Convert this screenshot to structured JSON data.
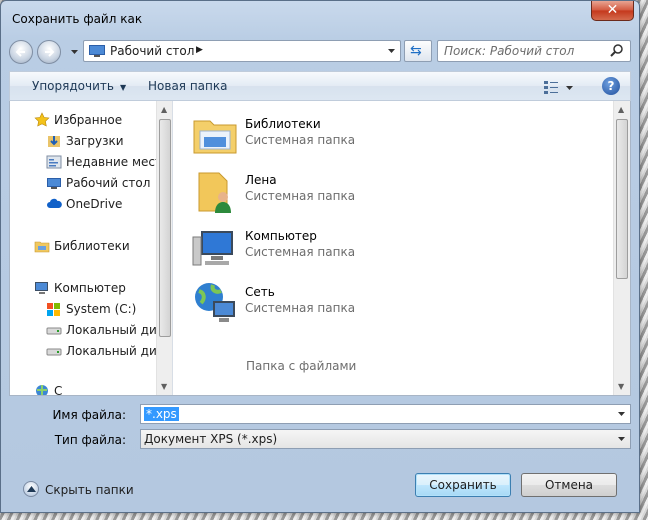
{
  "window": {
    "title": "Сохранить файл как",
    "close_glyph": "✕"
  },
  "navbar": {
    "address": "Рабочий стол",
    "address_arrow": "▶",
    "search_placeholder": "Поиск: Рабочий стол"
  },
  "toolbar": {
    "organize_label": "Упорядочить",
    "new_folder_label": "Новая папка",
    "help_glyph": "?"
  },
  "sidebar": {
    "items": [
      {
        "label": "Избранное",
        "icon": "star-icon"
      },
      {
        "label": "Загрузки",
        "icon": "downloads-icon"
      },
      {
        "label": "Недавние места",
        "icon": "recent-places-icon"
      },
      {
        "label": "Рабочий стол",
        "icon": "desktop-icon"
      },
      {
        "label": "OneDrive",
        "icon": "onedrive-icon"
      },
      {
        "label": "Библиотеки",
        "icon": "libraries-icon"
      },
      {
        "label": "Компьютер",
        "icon": "computer-icon"
      },
      {
        "label": "System (C:)",
        "icon": "system-drive-icon"
      },
      {
        "label": "Локальный диск",
        "icon": "local-disk-icon"
      },
      {
        "label": "Локальный диск",
        "icon": "local-disk-icon"
      },
      {
        "label": "С",
        "icon": "network-icon"
      }
    ]
  },
  "files": [
    {
      "name": "Библиотеки",
      "type": "Системная папка",
      "icon": "libraries-folder-icon"
    },
    {
      "name": "Лена",
      "type": "Системная папка",
      "icon": "user-folder-icon"
    },
    {
      "name": "Компьютер",
      "type": "Системная папка",
      "icon": "computer-icon"
    },
    {
      "name": "Сеть",
      "type": "Системная папка",
      "icon": "network-globe-icon"
    }
  ],
  "group_label": "Папка с файлами",
  "form": {
    "filename_label": "Имя файла:",
    "filename_value": "*.xps",
    "filetype_label": "Тип файла:",
    "filetype_value": "Документ XPS (*.xps)"
  },
  "footer": {
    "hide_folders_label": "Скрыть папки",
    "save_label": "Сохранить",
    "cancel_label": "Отмена"
  },
  "colors": {
    "accent": "#3399ff",
    "primary_button": "#bee6fd",
    "close_button": "#c4371b"
  }
}
